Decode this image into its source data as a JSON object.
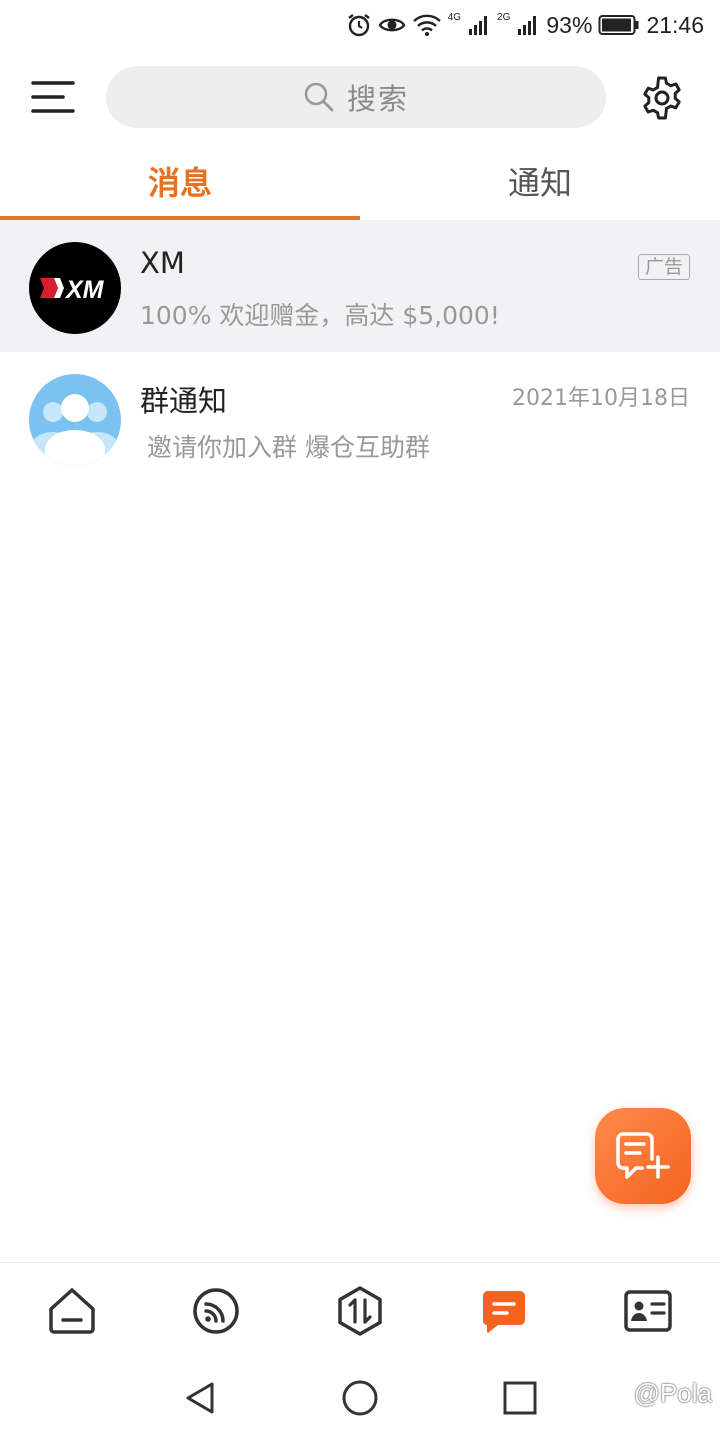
{
  "status_bar": {
    "battery_percent": "93%",
    "time": "21:46",
    "network_1": "4G",
    "network_2": "2G",
    "icons": [
      "alarm-icon",
      "eye-icon",
      "wifi-icon",
      "signal-icon",
      "signal-icon",
      "battery-icon"
    ]
  },
  "top_bar": {
    "search_placeholder": "搜索",
    "icons": [
      "menu-icon",
      "search-icon",
      "gear-icon"
    ]
  },
  "tabs": [
    {
      "label": "消息",
      "active": true
    },
    {
      "label": "通知",
      "active": false
    }
  ],
  "conversations": [
    {
      "name": "XM",
      "preview": "100% 欢迎赠金，高达 $5,000!",
      "badge": "广告",
      "avatar": "XM"
    },
    {
      "name": "群通知",
      "preview": "邀请你加入群 爆仓互助群",
      "date": "2021年10月18日"
    }
  ],
  "bottom_nav": {
    "items": [
      "home-icon",
      "rss-icon",
      "trade-icon",
      "messages-icon",
      "contacts-icon"
    ],
    "active": "messages-icon"
  },
  "watermark": "@Pola",
  "colors": {
    "accent": "#e8711e",
    "fab": "#f4631f",
    "ad_background": "#f2f2f4"
  }
}
